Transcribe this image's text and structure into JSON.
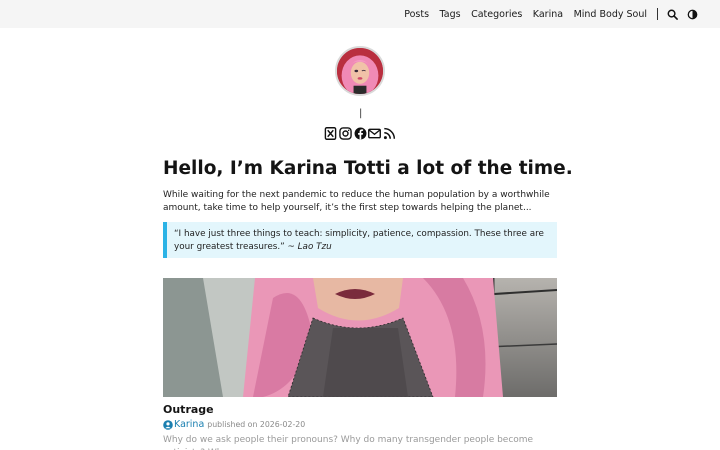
{
  "nav": {
    "items": [
      "Posts",
      "Tags",
      "Categories",
      "Karina",
      "Mind Body Soul"
    ],
    "icons": [
      "search-icon",
      "theme-toggle-icon"
    ]
  },
  "profile": {
    "separator": "|",
    "social_icons": [
      "x-twitter-icon",
      "instagram-icon",
      "facebook-icon",
      "email-icon",
      "rss-icon"
    ]
  },
  "headline": "Hello, I’m Karina Totti a lot of the time.",
  "intro": "While waiting for the next pandemic to reduce the human population by a worthwhile amount, take time to help yourself, it’s the first step towards helping the planet...",
  "quote": {
    "text": "“I have just three things to teach: simplicity, patience, compassion. These three are your greatest treasures.” ~ ",
    "author": "Lao Tzu"
  },
  "post": {
    "title": "Outrage",
    "author": "Karina",
    "published_label": "published on 2026-02-20",
    "excerpt": "Why do we ask people their pronouns? Why do many transgender people become activists? Why"
  },
  "colors": {
    "accent": "#2bb3e6",
    "quote_bg": "#e3f6fc",
    "link": "#1a7fb0",
    "nav_bg": "#f5f5f5"
  }
}
